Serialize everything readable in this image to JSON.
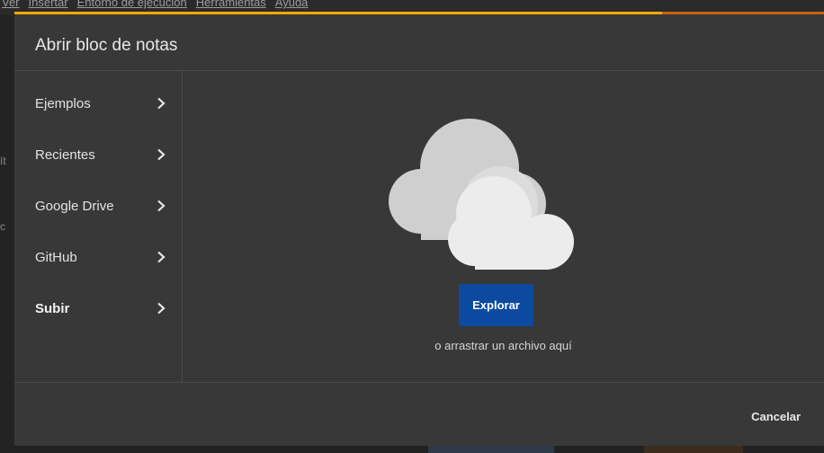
{
  "background": {
    "menu": [
      "Ver",
      "Insertar",
      "Entorno de ejecución",
      "Herramientas",
      "Ayuda"
    ],
    "fragments": [
      "ít",
      "c"
    ]
  },
  "dialog": {
    "title": "Abrir bloc de notas",
    "progress_fraction": 0.8,
    "sidebar": {
      "items": [
        {
          "label": "Ejemplos",
          "active": false
        },
        {
          "label": "Recientes",
          "active": false
        },
        {
          "label": "Google Drive",
          "active": false
        },
        {
          "label": "GitHub",
          "active": false
        },
        {
          "label": "Subir",
          "active": true
        }
      ]
    },
    "upload": {
      "icon": "cloud-icon",
      "explore_label": "Explorar",
      "drag_hint": "o arrastrar un archivo aquí"
    },
    "cancel_label": "Cancelar"
  },
  "colors": {
    "dialog_bg": "#383838",
    "primary_button": "#0b4aa0",
    "progress_fill": "#f6a800",
    "progress_track": "#c8620f"
  }
}
